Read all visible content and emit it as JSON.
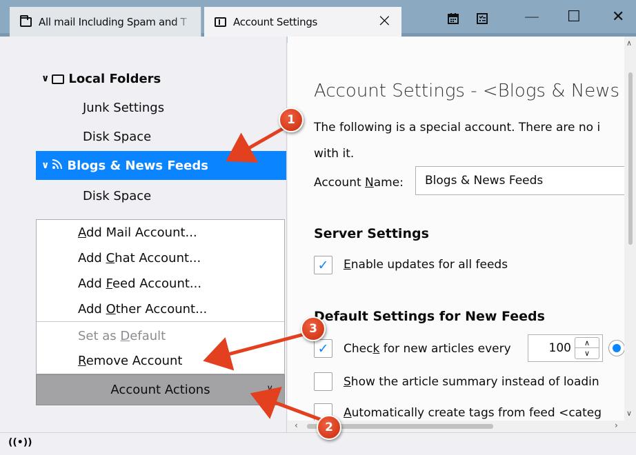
{
  "tabs": [
    {
      "label": "All mail Including Spam and T",
      "icon": "folder-icon"
    },
    {
      "label": "Account Settings",
      "icon": "settings-page-icon"
    }
  ],
  "window_controls": {
    "minimize": "—",
    "maximize": "☐",
    "close": "✕"
  },
  "tree": {
    "local_folders": "Local Folders",
    "junk_settings": "Junk Settings",
    "disk_space_1": "Disk Space",
    "blogs_feeds": "Blogs & News Feeds",
    "disk_space_2": "Disk Space"
  },
  "account_actions_menu": {
    "add_mail": {
      "pre": "",
      "key": "A",
      "post": "dd Mail Account..."
    },
    "add_chat": {
      "pre": "Add ",
      "key": "C",
      "post": "hat Account..."
    },
    "add_feed": {
      "pre": "Add ",
      "key": "F",
      "post": "eed Account..."
    },
    "add_other": {
      "pre": "Add ",
      "key": "O",
      "post": "ther Account..."
    },
    "set_default": {
      "pre": "Set as ",
      "key": "D",
      "post": "efault"
    },
    "remove": {
      "pre": "",
      "key": "R",
      "post": "emove Account"
    }
  },
  "account_actions_button": "Account Actions",
  "settings": {
    "title": "Account Settings - <Blogs & News",
    "desc_line1": "The following is a special account. There are no i",
    "desc_line2": "with it.",
    "account_name_label": {
      "pre": "Account ",
      "key": "N",
      "post": "ame:"
    },
    "account_name_value": "Blogs & News Feeds",
    "server_settings": "Server Settings",
    "enable_updates": {
      "pre": "",
      "key": "E",
      "post": "nable updates for all feeds",
      "checked": true
    },
    "default_settings": "Default Settings for New Feeds",
    "check_articles": {
      "pre": "Chec",
      "key": "k",
      "post": " for new articles every",
      "checked": true
    },
    "check_interval": "100",
    "show_summary": {
      "pre": "",
      "key": "S",
      "post": "how the article summary instead of loadin",
      "checked": false
    },
    "auto_tags": {
      "pre": "",
      "key": "A",
      "post": "utomatically create tags from feed <categ",
      "checked": false
    }
  },
  "annotations": [
    "1",
    "2",
    "3"
  ],
  "colors": {
    "selection": "#0a84ff",
    "annotation": "#e2401f",
    "tabbar": "#8ba9c1"
  }
}
